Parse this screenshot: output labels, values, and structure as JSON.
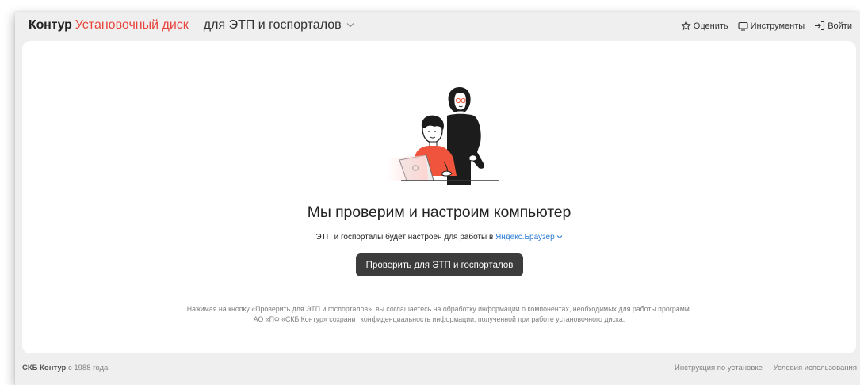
{
  "header": {
    "brand": "Контур",
    "product": "Установочный диск",
    "product_variant": "для ЭТП и госпорталов",
    "links": {
      "rate": "Оценить",
      "tools": "Инструменты",
      "login": "Войти"
    }
  },
  "main": {
    "title": "Мы проверим и настроим компьютер",
    "subline_prefix": "ЭТП и госпорталы будет настроен для работы в",
    "browser": "Яндекс.Браузер",
    "check_button": "Проверить для ЭТП и госпорталов",
    "disclaimer_line1": "Нажимая на кнопку «Проверить для ЭТП и госпорталов», вы соглашаетесь на обработку информации о компонентах, необходимых для работы программ.",
    "disclaimer_line2": "АО «ПФ «СКБ Контур» сохранит конфиденциальность информации, полученной при работе установочного диска."
  },
  "footer": {
    "company": "СКБ Контур",
    "since": "с 1988 года",
    "install_guide": "Инструкция по установке",
    "terms": "Условия использования"
  },
  "colors": {
    "brand_red": "#e8443c",
    "link_blue": "#2b7bd6",
    "button_dark": "#3c3c3c",
    "illustration_red": "#f0543c"
  },
  "icons": [
    "star-icon",
    "monitor-icon",
    "login-arrow-icon",
    "chevron-down-icon"
  ]
}
